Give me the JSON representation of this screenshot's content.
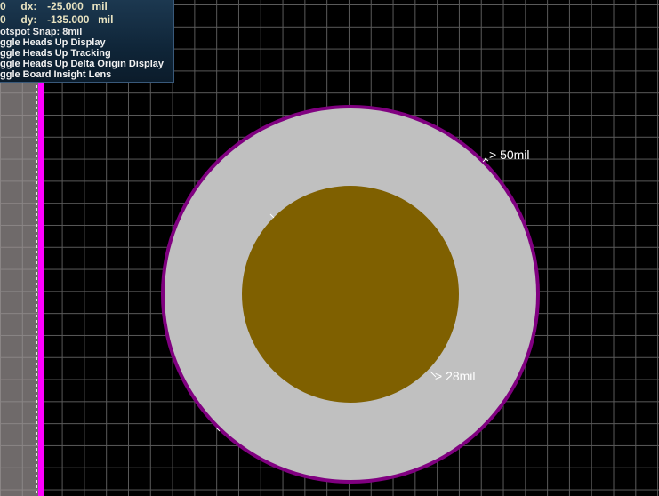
{
  "hud": {
    "row1_prefix": "0",
    "row1_label": "dx:",
    "row1_value": "-25.000",
    "row1_unit": "mil",
    "row2_prefix": "0",
    "row2_label": "dy:",
    "row2_value": "-135.000",
    "row2_unit": "mil",
    "snap": "otspot Snap: 8mil",
    "commands": [
      "ggle Heads Up Display",
      "ggle Heads Up Tracking",
      "ggle Heads Up Delta Origin Display",
      "ggle Board Insight Lens"
    ]
  },
  "pad": {
    "outer_label": "> 50mil",
    "inner_label": "> 28mil",
    "copper_color": "#c0c0c0",
    "hole_color": "#7f6000",
    "outline_color": "#800080"
  },
  "colors": {
    "background": "#000000",
    "grid": "#5a5a5a",
    "keepout": "#ff00ff",
    "board_edge": "#6f6a6a"
  }
}
